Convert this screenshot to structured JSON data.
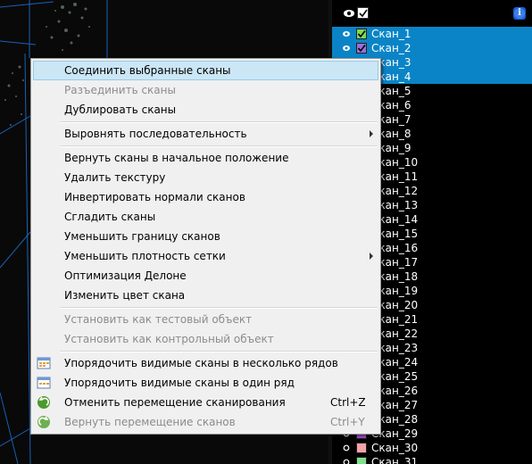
{
  "panel": {
    "header": {
      "eye_icon": "eye-icon",
      "check_icon": "checkbox-checked-icon",
      "info_icon": "info-icon",
      "info_glyph": "i"
    },
    "selection_color": "#0a84c6",
    "scans": [
      {
        "label": "Скан_1",
        "color": "#7ed957",
        "selected": true,
        "visible": true,
        "checked": true
      },
      {
        "label": "Скан_2",
        "color": "#9b6fd8",
        "selected": true,
        "visible": true,
        "checked": true
      },
      {
        "label": "Скан_3",
        "color": "#0a84c6",
        "selected": true,
        "visible": true,
        "checked": false
      },
      {
        "label": "Скан_4",
        "color": "#0a84c6",
        "selected": true,
        "visible": true,
        "checked": false
      },
      {
        "label": "Скан_5",
        "color": "#000000",
        "selected": false,
        "visible": true,
        "checked": false
      },
      {
        "label": "Скан_6",
        "color": "#000000",
        "selected": false,
        "visible": true,
        "checked": false
      },
      {
        "label": "Скан_7",
        "color": "#000000",
        "selected": false,
        "visible": true,
        "checked": false
      },
      {
        "label": "Скан_8",
        "color": "#000000",
        "selected": false,
        "visible": true,
        "checked": false
      },
      {
        "label": "Скан_9",
        "color": "#000000",
        "selected": false,
        "visible": true,
        "checked": false
      },
      {
        "label": "Скан_10",
        "color": "#000000",
        "selected": false,
        "visible": true,
        "checked": false
      },
      {
        "label": "Скан_11",
        "color": "#000000",
        "selected": false,
        "visible": true,
        "checked": false
      },
      {
        "label": "Скан_12",
        "color": "#000000",
        "selected": false,
        "visible": true,
        "checked": false
      },
      {
        "label": "Скан_13",
        "color": "#000000",
        "selected": false,
        "visible": true,
        "checked": false
      },
      {
        "label": "Скан_14",
        "color": "#000000",
        "selected": false,
        "visible": true,
        "checked": false
      },
      {
        "label": "Скан_15",
        "color": "#000000",
        "selected": false,
        "visible": true,
        "checked": false
      },
      {
        "label": "Скан_16",
        "color": "#000000",
        "selected": false,
        "visible": true,
        "checked": false
      },
      {
        "label": "Скан_17",
        "color": "#000000",
        "selected": false,
        "visible": true,
        "checked": false
      },
      {
        "label": "Скан_18",
        "color": "#000000",
        "selected": false,
        "visible": true,
        "checked": false
      },
      {
        "label": "Скан_19",
        "color": "#000000",
        "selected": false,
        "visible": true,
        "checked": false
      },
      {
        "label": "Скан_20",
        "color": "#000000",
        "selected": false,
        "visible": true,
        "checked": false
      },
      {
        "label": "Скан_21",
        "color": "#000000",
        "selected": false,
        "visible": true,
        "checked": false
      },
      {
        "label": "Скан_22",
        "color": "#000000",
        "selected": false,
        "visible": true,
        "checked": false
      },
      {
        "label": "Скан_23",
        "color": "#000000",
        "selected": false,
        "visible": true,
        "checked": false
      },
      {
        "label": "Скан_24",
        "color": "#000000",
        "selected": false,
        "visible": true,
        "checked": false
      },
      {
        "label": "Скан_25",
        "color": "#000000",
        "selected": false,
        "visible": true,
        "checked": false
      },
      {
        "label": "Скан_26",
        "color": "#000000",
        "selected": false,
        "visible": true,
        "checked": false
      },
      {
        "label": "Скан_27",
        "color": "#000000",
        "selected": false,
        "visible": true,
        "checked": false
      },
      {
        "label": "Скан_28",
        "color": "#000000",
        "selected": false,
        "visible": true,
        "checked": false
      },
      {
        "label": "Скан_29",
        "color": "#a64fd0",
        "selected": false,
        "visible": false,
        "checked": false
      },
      {
        "label": "Скан_30",
        "color": "#f4a3a8",
        "selected": false,
        "visible": false,
        "checked": false
      },
      {
        "label": "Скан_31",
        "color": "#7ee08a",
        "selected": false,
        "visible": false,
        "checked": false
      }
    ]
  },
  "menu": {
    "items": [
      {
        "label": "Соединить выбранные сканы",
        "disabled": false,
        "highlighted": true
      },
      {
        "label": "Разъединить сканы",
        "disabled": true
      },
      {
        "label": "Дублировать сканы",
        "disabled": false
      },
      {
        "sep": true
      },
      {
        "label": "Выровнять последовательность",
        "disabled": false,
        "submenu": true
      },
      {
        "sep": true
      },
      {
        "label": "Вернуть сканы в начальное положение",
        "disabled": false
      },
      {
        "label": "Удалить текстуру",
        "disabled": false
      },
      {
        "label": "Инвертировать нормали сканов",
        "disabled": false
      },
      {
        "label": "Сгладить сканы",
        "disabled": false
      },
      {
        "label": "Уменьшить границу сканов",
        "disabled": false
      },
      {
        "label": "Уменьшить плотность сетки",
        "disabled": false,
        "submenu": true
      },
      {
        "label": "Оптимизация Делоне",
        "disabled": false
      },
      {
        "label": "Изменить цвет скана",
        "disabled": false
      },
      {
        "sep": true
      },
      {
        "label": "Установить как тестовый объект",
        "disabled": true
      },
      {
        "label": "Установить как контрольный объект",
        "disabled": true
      },
      {
        "sep": true
      },
      {
        "label": "Упорядочить видимые сканы в несколько рядов",
        "disabled": false,
        "icon": "grid-arrange-icon"
      },
      {
        "label": "Упорядочить видимые сканы в один ряд",
        "disabled": false,
        "icon": "row-arrange-icon"
      },
      {
        "label": "Отменить перемещение сканирования",
        "disabled": false,
        "icon": "undo-icon",
        "shortcut": "Ctrl+Z"
      },
      {
        "label": "Вернуть перемещение сканов",
        "disabled": true,
        "icon": "redo-icon",
        "shortcut": "Ctrl+Y"
      }
    ]
  }
}
